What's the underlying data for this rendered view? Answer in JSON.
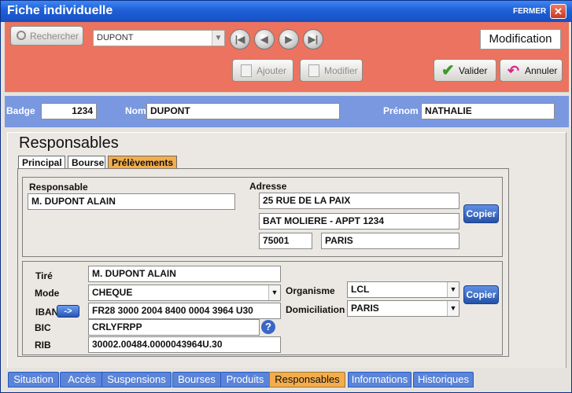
{
  "window": {
    "title": "Fiche individuelle",
    "close_label": "FERMER",
    "close_glyph": "✕"
  },
  "toolbar": {
    "search_label": "Rechercher",
    "search_value": "DUPONT",
    "mode_label": "Modification",
    "add_label": "Ajouter",
    "edit_label": "Modifier",
    "validate_label": "Valider",
    "cancel_label": "Annuler",
    "nav": {
      "first": "|◀",
      "prev": "◀",
      "next": "▶",
      "last": "▶|"
    }
  },
  "identity": {
    "badge_label": "Badge",
    "badge_value": "1234",
    "nom_label": "Nom",
    "nom_value": "DUPONT",
    "prenom_label": "Prénom",
    "prenom_value": "NATHALIE"
  },
  "section": {
    "title": "Responsables",
    "tabs": [
      {
        "label": "Principal",
        "selected": false
      },
      {
        "label": "Bourse",
        "selected": false
      },
      {
        "label": "Prélèvements",
        "selected": true
      }
    ]
  },
  "responsable": {
    "label": "Responsable",
    "value": "M. DUPONT ALAIN",
    "adresse_label": "Adresse",
    "adresse1": "25 RUE DE LA PAIX",
    "adresse2": "BAT MOLIERE - APPT 1234",
    "code_postal": "75001",
    "ville": "PARIS",
    "copy_label": "Copier"
  },
  "bank": {
    "tire_label": "Tiré",
    "tire_value": "M. DUPONT ALAIN",
    "mode_label": "Mode",
    "mode_value": "CHEQUE",
    "iban_label": "IBAN",
    "iban_button": "->",
    "iban_value": "FR28 3000 2004 8400 0004 3964 U30",
    "bic_label": "BIC",
    "bic_value": "CRLYFRPP",
    "help": "?",
    "rib_label": "RIB",
    "rib_value": "30002.00484.0000043964U.30",
    "organisme_label": "Organisme",
    "organisme_value": "LCL",
    "domiciliation_label": "Domiciliation",
    "domiciliation_value": "PARIS",
    "copy_label": "Copier"
  },
  "bottom_tabs": [
    {
      "label": "Situation",
      "selected": false
    },
    {
      "label": "Accès",
      "selected": false
    },
    {
      "label": "Suspensions",
      "selected": false
    },
    {
      "label": "Bourses",
      "selected": false
    },
    {
      "label": "Produits",
      "selected": false
    },
    {
      "label": "Responsables",
      "selected": true
    },
    {
      "label": "Informations",
      "selected": false
    },
    {
      "label": "Historiques",
      "selected": false
    }
  ]
}
